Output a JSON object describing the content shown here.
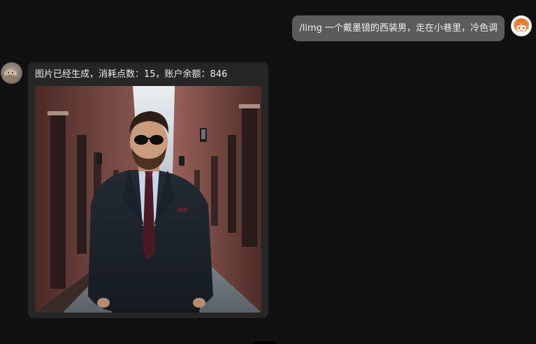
{
  "user_message": {
    "text": "/limg 一个戴墨镜的西装男，走在小巷里，冷色调",
    "avatar_icon": "anime-girl-avatar"
  },
  "bot_message": {
    "text": "图片已经生成，消耗点数：15，账户余额：846",
    "avatar_icon": "cat-photo-avatar",
    "image_subject": "man-in-suit-sunglasses-alley"
  },
  "colors": {
    "background": "#111111",
    "user_bubble": "#5b5b5b",
    "bot_bubble": "#262626",
    "text": "#ececec"
  }
}
